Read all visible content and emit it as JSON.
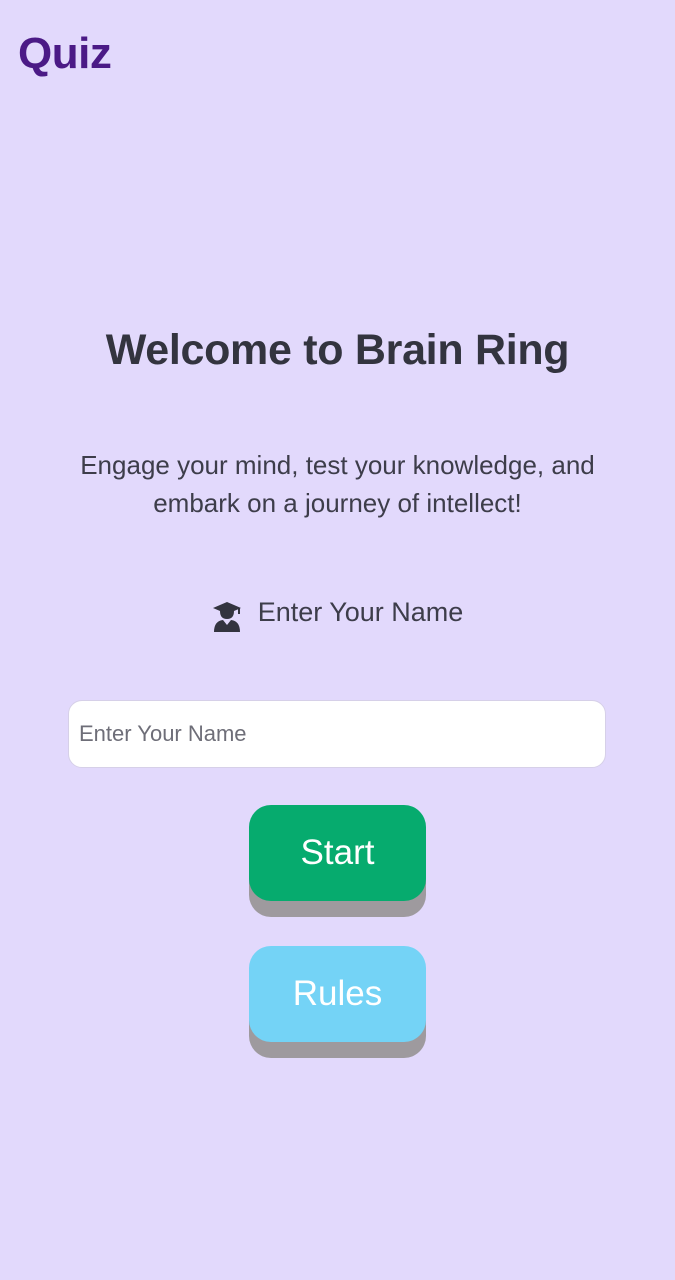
{
  "header": {
    "brand": "Quiz"
  },
  "main": {
    "title": "Welcome to Brain Ring",
    "subtitle": "Engage your mind, test your knowledge, and embark on a journey of intellect!",
    "name_label": "Enter Your Name",
    "name_label_icon": "graduate-icon",
    "name_input": {
      "value": "",
      "placeholder": "Enter Your Name"
    },
    "start_label": "Start",
    "rules_label": "Rules"
  },
  "colors": {
    "background": "#e2d9fc",
    "brand": "#4b1a86",
    "start_button": "#06ab6e",
    "rules_button": "#74d3f6",
    "button_shadow": "#9e9a9e"
  }
}
